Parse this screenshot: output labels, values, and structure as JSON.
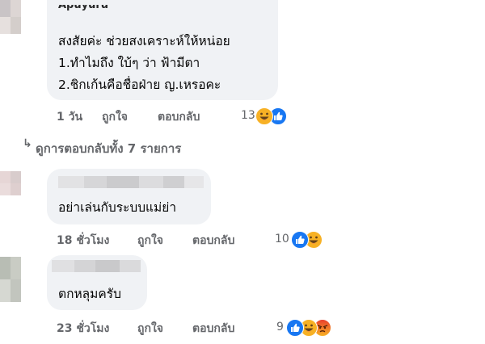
{
  "comments": [
    {
      "name_label": "Apuyuru",
      "lines": [
        "สงสัยค่ะ ช่วยสงเคราะห์ให้หน่อย",
        "1.ทำไมถึง ใบ้ๆ ว่า ฟ้ามีตา",
        "2.ชิกเก้นคือชื่อฝ่าย ญ.เหรอคะ"
      ],
      "time": "1 วัน",
      "like_label": "ถูกใจ",
      "reply_label": "ตอบกลับ",
      "reaction_count": "13",
      "reactions": [
        "haha-icon",
        "like-icon"
      ]
    },
    {
      "lines": [
        "อย่าเล่นกับระบบแม่ย่า"
      ],
      "time": "18 ชั่วโมง",
      "like_label": "ถูกใจ",
      "reply_label": "ตอบกลับ",
      "reaction_count": "10",
      "reactions": [
        "like-icon",
        "haha-icon"
      ]
    },
    {
      "lines": [
        "ตกหลุมครับ"
      ],
      "time": "23 ชั่วโมง",
      "like_label": "ถูกใจ",
      "reply_label": "ตอบกลับ",
      "reaction_count": "9",
      "reactions": [
        "like-icon",
        "haha-icon",
        "angry-icon"
      ]
    }
  ],
  "view_replies": "ดูการตอบกลับทั้ง 7 รายการ",
  "colors": {
    "bubble": "#f0f2f5",
    "meta_text": "#65676b",
    "like": "#1877f2",
    "haha": "#f7b125",
    "angry": "#e9710f"
  }
}
